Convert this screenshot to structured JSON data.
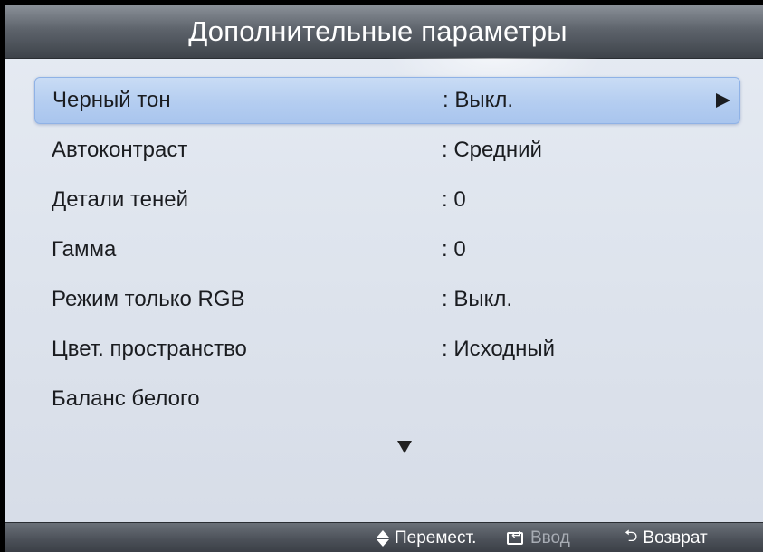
{
  "header": {
    "title": "Дополнительные параметры"
  },
  "menu": {
    "items": [
      {
        "label": "Черный тон",
        "value": ": Выкл.",
        "selected": true
      },
      {
        "label": "Автоконтраст",
        "value": ": Средний"
      },
      {
        "label": "Детали теней",
        "value": ": 0"
      },
      {
        "label": "Гамма",
        "value": ": 0"
      },
      {
        "label": "Режим только RGB",
        "value": ": Выкл."
      },
      {
        "label": "Цвет. пространство",
        "value": ": Исходный"
      },
      {
        "label": "Баланс белого",
        "value": ""
      }
    ]
  },
  "footer": {
    "move_label": "Перемест.",
    "enter_label": "Ввод",
    "return_label": "Возврат"
  },
  "icons": {
    "selected_arrow": "triangle-right-icon",
    "scroll": "triangle-down-icon",
    "move": "updown-arrows-icon",
    "enter": "enter-icon",
    "return": "return-icon"
  },
  "colors": {
    "highlight": "#b4cdf0",
    "title_bar": "#5e646c",
    "panel": "#dfe5ee"
  }
}
